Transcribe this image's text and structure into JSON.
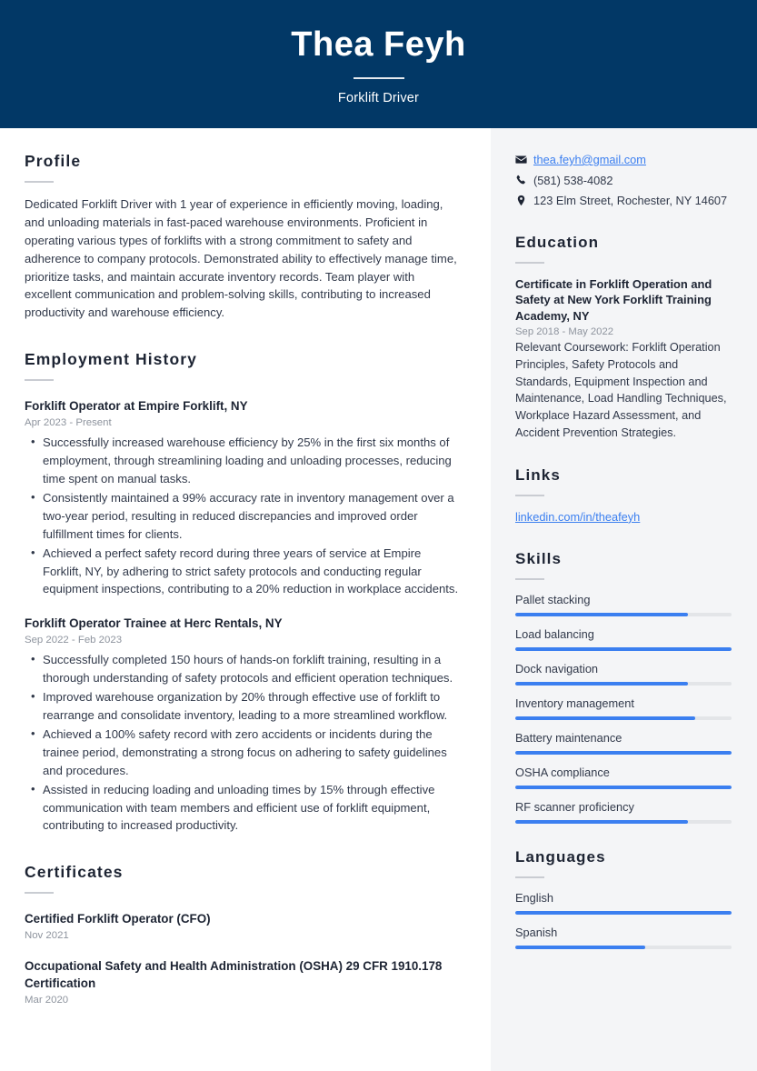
{
  "header": {
    "name": "Thea Feyh",
    "job_title": "Forklift Driver",
    "background_color": "#023866"
  },
  "accent_color": "#3b7ff0",
  "main": {
    "profile": {
      "heading": "Profile",
      "text": "Dedicated Forklift Driver with 1 year of experience in efficiently moving, loading, and unloading materials in fast-paced warehouse environments. Proficient in operating various types of forklifts with a strong commitment to safety and adherence to company protocols. Demonstrated ability to effectively manage time, prioritize tasks, and maintain accurate inventory records. Team player with excellent communication and problem-solving skills, contributing to increased productivity and warehouse efficiency."
    },
    "employment": {
      "heading": "Employment History",
      "jobs": [
        {
          "title": "Forklift Operator at Empire Forklift, NY",
          "date": "Apr 2023 - Present",
          "bullets": [
            "Successfully increased warehouse efficiency by 25% in the first six months of employment, through streamlining loading and unloading processes, reducing time spent on manual tasks.",
            "Consistently maintained a 99% accuracy rate in inventory management over a two-year period, resulting in reduced discrepancies and improved order fulfillment times for clients.",
            "Achieved a perfect safety record during three years of service at Empire Forklift, NY, by adhering to strict safety protocols and conducting regular equipment inspections, contributing to a 20% reduction in workplace accidents."
          ]
        },
        {
          "title": "Forklift Operator Trainee at Herc Rentals, NY",
          "date": "Sep 2022 - Feb 2023",
          "bullets": [
            "Successfully completed 150 hours of hands-on forklift training, resulting in a thorough understanding of safety protocols and efficient operation techniques.",
            "Improved warehouse organization by 20% through effective use of forklift to rearrange and consolidate inventory, leading to a more streamlined workflow.",
            "Achieved a 100% safety record with zero accidents or incidents during the trainee period, demonstrating a strong focus on adhering to safety guidelines and procedures.",
            "Assisted in reducing loading and unloading times by 15% through effective communication with team members and efficient use of forklift equipment, contributing to increased productivity."
          ]
        }
      ]
    },
    "certificates": {
      "heading": "Certificates",
      "items": [
        {
          "title": "Certified Forklift Operator (CFO)",
          "date": "Nov 2021"
        },
        {
          "title": "Occupational Safety and Health Administration (OSHA) 29 CFR 1910.178 Certification",
          "date": "Mar 2020"
        }
      ]
    }
  },
  "sidebar": {
    "contact": [
      {
        "icon": "envelope-icon",
        "text": "thea.feyh@gmail.com",
        "is_link": true
      },
      {
        "icon": "phone-icon",
        "text": "(581) 538-4082",
        "is_link": false
      },
      {
        "icon": "location-pin-icon",
        "text": "123 Elm Street, Rochester, NY 14607",
        "is_link": false
      }
    ],
    "education": {
      "heading": "Education",
      "items": [
        {
          "title": "Certificate in Forklift Operation and Safety at New York Forklift Training Academy, NY",
          "date": "Sep 2018 - May 2022",
          "description": "Relevant Coursework: Forklift Operation Principles, Safety Protocols and Standards, Equipment Inspection and Maintenance, Load Handling Techniques, Workplace Hazard Assessment, and Accident Prevention Strategies."
        }
      ]
    },
    "links": {
      "heading": "Links",
      "items": [
        {
          "label": "linkedin.com/in/theafeyh"
        }
      ]
    },
    "skills": {
      "heading": "Skills",
      "items": [
        {
          "label": "Pallet stacking",
          "level": 80
        },
        {
          "label": "Load balancing",
          "level": 100
        },
        {
          "label": "Dock navigation",
          "level": 80
        },
        {
          "label": "Inventory management",
          "level": 83
        },
        {
          "label": "Battery maintenance",
          "level": 100
        },
        {
          "label": "OSHA compliance",
          "level": 100
        },
        {
          "label": "RF scanner proficiency",
          "level": 80
        }
      ]
    },
    "languages": {
      "heading": "Languages",
      "items": [
        {
          "label": "English",
          "level": 100
        },
        {
          "label": "Spanish",
          "level": 60
        }
      ]
    }
  }
}
